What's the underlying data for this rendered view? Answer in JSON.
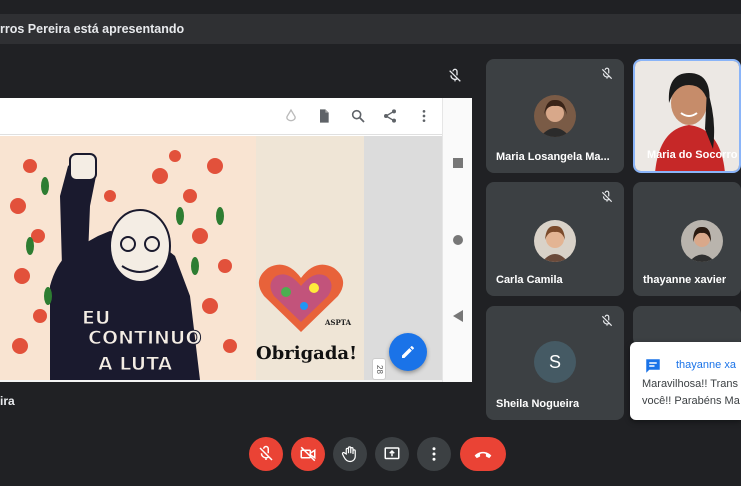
{
  "topbar": {
    "presenting_text": "rros Pereira está apresentando"
  },
  "presentation": {
    "page_number": "28",
    "thanks_text": "Obrigada!",
    "heart_logo_text": "ASPTA",
    "presenter_name": "ira"
  },
  "participants": [
    {
      "name": "Maria Losangela Ma...",
      "muted": true
    },
    {
      "name": "Maria do Socorro",
      "active_speaker": true
    },
    {
      "name": "Carla Camila",
      "muted": true
    },
    {
      "name": "thayanne xavier"
    },
    {
      "name": "Sheila Nogueira",
      "initial": "S",
      "muted": true
    }
  ],
  "chat_notification": {
    "sender": "thayanne xa",
    "message_line1": "Maravilhosa!! Trans",
    "message_line2": "você!! Parabéns Ma"
  },
  "controls": [
    {
      "icon": "mic-off-icon",
      "color": "#ea4335"
    },
    {
      "icon": "camera-off-icon",
      "color": "#ea4335"
    },
    {
      "icon": "raise-hand-icon",
      "color": "#3c4043"
    },
    {
      "icon": "present-screen-icon",
      "color": "#3c4043"
    },
    {
      "icon": "more-vert-icon",
      "color": "#3c4043"
    },
    {
      "icon": "hang-up-icon",
      "color": "#ea4335"
    }
  ],
  "colors": {
    "background": "#202124",
    "tile": "#3c4043",
    "accent": "#1a73e8",
    "danger": "#ea4335"
  }
}
